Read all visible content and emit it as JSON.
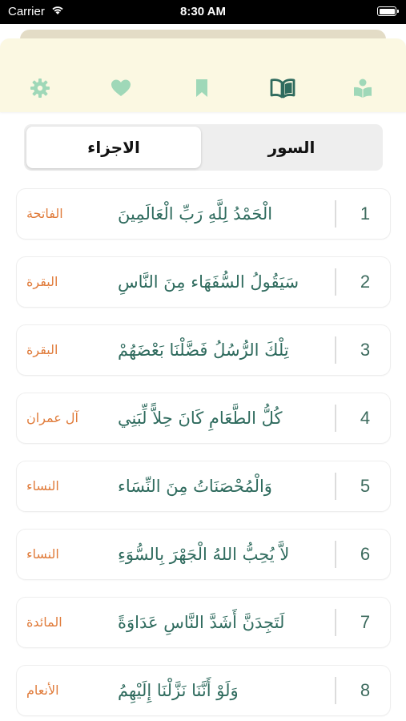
{
  "status_bar": {
    "carrier": "Carrier",
    "time": "8:30 AM"
  },
  "tab_bar": {
    "icons": [
      "gear-icon",
      "heart-icon",
      "bookmark-icon",
      "open-book-icon",
      "reader-icon"
    ],
    "selected": "open-book-icon",
    "active_color": "#2f6b5e",
    "inactive_color": "#9fd8b8"
  },
  "segmented": {
    "selected_label": "الاجزاء",
    "other_label": "السور"
  },
  "juz_list": [
    {
      "number": "1",
      "verse": "الْحَمْدُ لِلَّهِ رَبِّ الْعَالَمِينَ",
      "surah": "الفاتحة"
    },
    {
      "number": "2",
      "verse": "سَيَقُولُ السُّفَهَاء مِنَ النَّاسِ",
      "surah": "البقرة"
    },
    {
      "number": "3",
      "verse": "تِلْكَ الرُّسُلُ فَضَّلْنَا بَعْضَهُمْ",
      "surah": "البقرة"
    },
    {
      "number": "4",
      "verse": "كُلُّ الطَّعَامِ كَانَ حِلاًّ لِّبَنِي",
      "surah": "آل عمران"
    },
    {
      "number": "5",
      "verse": "وَالْمُحْصَنَاتُ مِنَ النِّسَاء",
      "surah": "النساء"
    },
    {
      "number": "6",
      "verse": "لاَّ يُحِبُّ اللهُ الْجَهْرَ بِالسُّوَءِ",
      "surah": "النساء"
    },
    {
      "number": "7",
      "verse": "لَتَجِدَنَّ أَشَدَّ النَّاسِ عَدَاوَةً",
      "surah": "المائدة"
    },
    {
      "number": "8",
      "verse": "وَلَوْ أَنَّنَا نَزَّلْنَا إِلَيْهِمُ",
      "surah": "الأنعام"
    }
  ]
}
